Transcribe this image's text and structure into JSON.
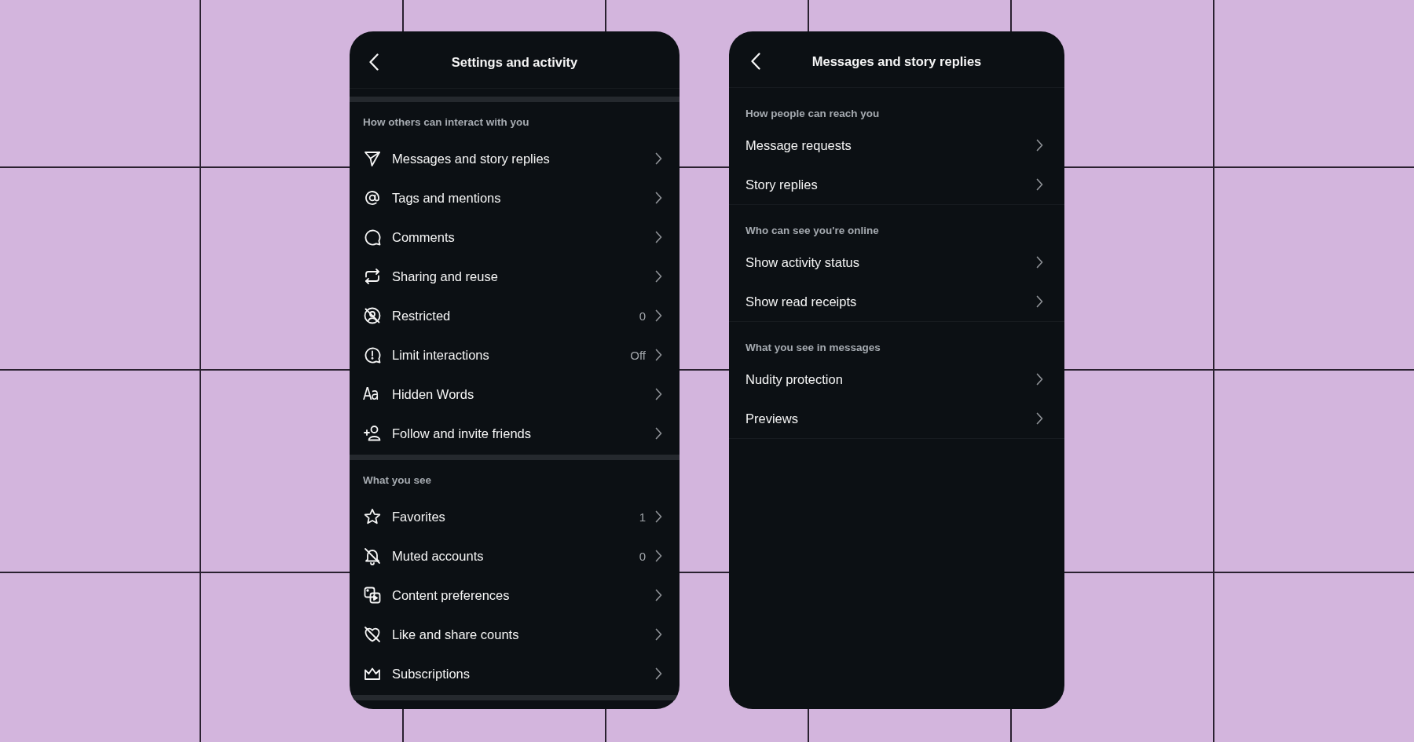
{
  "screens": [
    {
      "kind": "icon-list",
      "title": "Settings and activity",
      "sections": [
        {
          "heading": "How others can interact with you",
          "items": [
            {
              "label": "Messages and story replies"
            },
            {
              "label": "Tags and mentions"
            },
            {
              "label": "Comments"
            },
            {
              "label": "Sharing and reuse"
            },
            {
              "label": "Restricted",
              "value": "0"
            },
            {
              "label": "Limit interactions",
              "value": "Off"
            },
            {
              "label": "Hidden Words",
              "icon_text": "Aa"
            },
            {
              "label": "Follow and invite friends"
            }
          ]
        },
        {
          "heading": "What you see",
          "items": [
            {
              "label": "Favorites",
              "value": "1"
            },
            {
              "label": "Muted accounts",
              "value": "0"
            },
            {
              "label": "Content preferences"
            },
            {
              "label": "Like and share counts"
            },
            {
              "label": "Subscriptions"
            }
          ]
        }
      ]
    },
    {
      "kind": "plain-list",
      "title": "Messages and story replies",
      "sections": [
        {
          "heading": "How people can reach you",
          "items": [
            {
              "label": "Message requests"
            },
            {
              "label": "Story replies"
            }
          ]
        },
        {
          "heading": "Who can see you're online",
          "items": [
            {
              "label": "Show activity status"
            },
            {
              "label": "Show read receipts"
            }
          ]
        },
        {
          "heading": "What you see in messages",
          "items": [
            {
              "label": "Nudity protection"
            },
            {
              "label": "Previews"
            }
          ]
        }
      ]
    }
  ]
}
